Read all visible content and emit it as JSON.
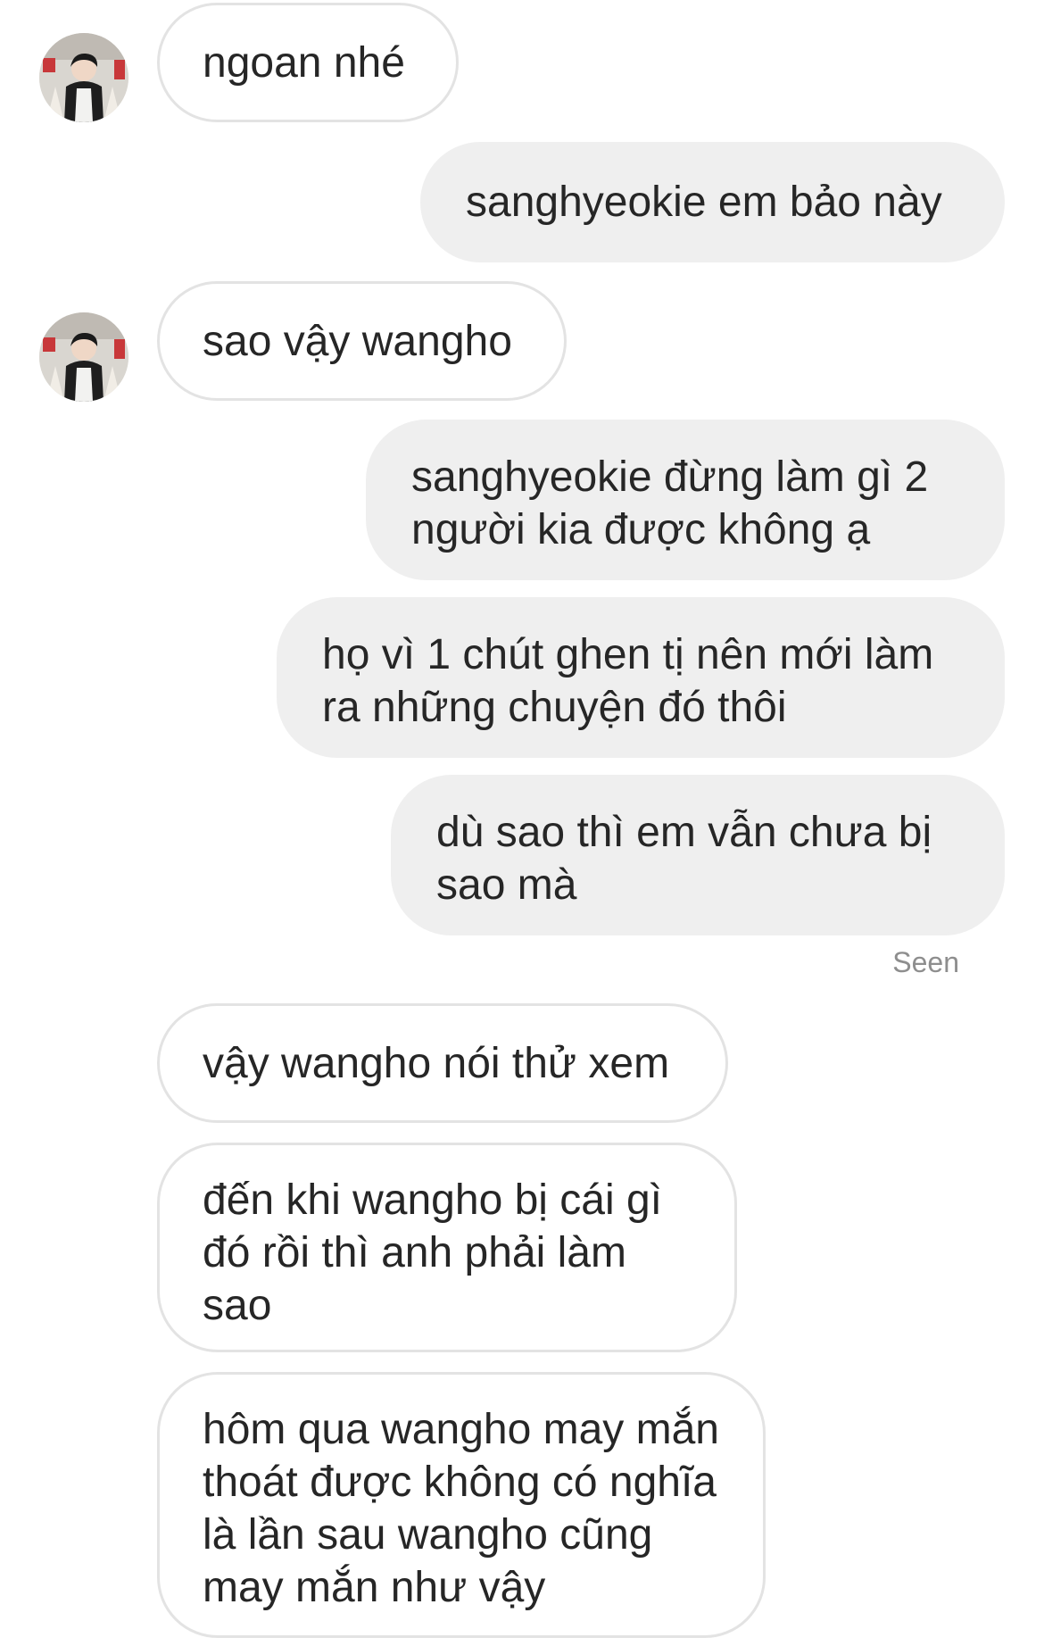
{
  "conversation": {
    "messages": [
      {
        "sender": "them",
        "text": "ngoan nhé"
      },
      {
        "sender": "me",
        "text": "sanghyeokie em bảo này"
      },
      {
        "sender": "them",
        "text": "sao vậy wangho"
      },
      {
        "sender": "me",
        "text": "sanghyeokie đừng làm gì 2 người kia được không ạ"
      },
      {
        "sender": "me",
        "text": "họ vì 1 chút ghen tị nên mới làm ra những chuyện đó thôi"
      },
      {
        "sender": "me",
        "text": "dù sao thì em vẫn chưa bị sao mà"
      },
      {
        "sender": "them",
        "text": "vậy wangho nói thử xem"
      },
      {
        "sender": "them",
        "text": "đến khi wangho bị cái gì đó rồi thì anh phải làm sao"
      },
      {
        "sender": "them",
        "text": "hôm qua wangho may mắn thoát được không có nghĩa là lần sau wangho cũng may mắn như vậy"
      }
    ],
    "seen_label": "Seen"
  },
  "colors": {
    "incoming_bubble_bg": "#ffffff",
    "incoming_bubble_border": "#e3e3e3",
    "outgoing_bubble_bg": "#efefef",
    "text": "#262626",
    "seen_text": "#8e8e8e"
  },
  "icons": {
    "contact_avatar": "avatar-photo"
  }
}
